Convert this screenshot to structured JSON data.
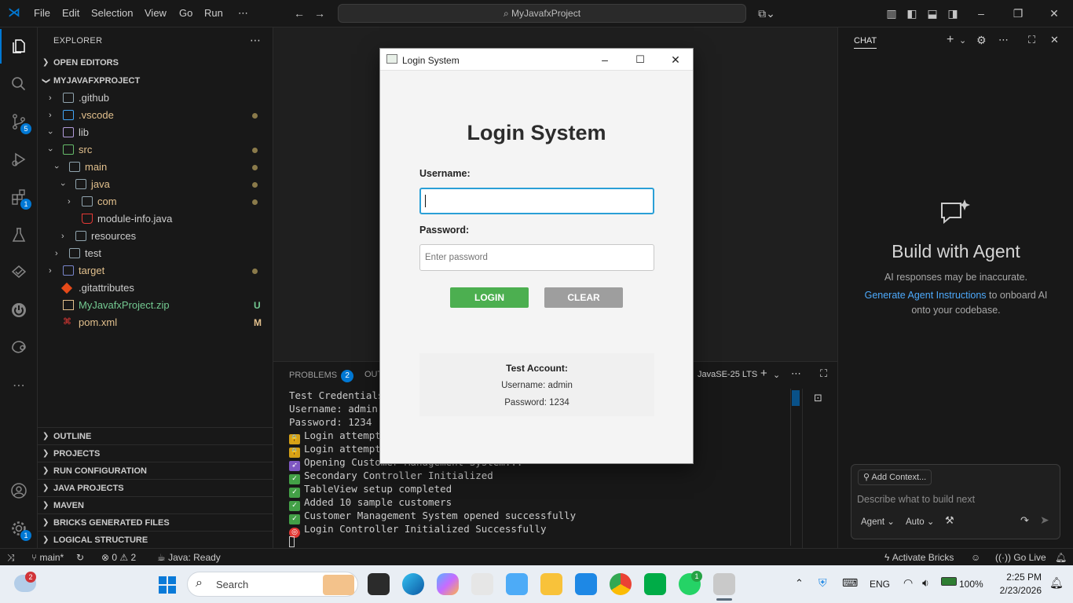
{
  "menu": {
    "file": "File",
    "edit": "Edit",
    "selection": "Selection",
    "view": "View",
    "go": "Go",
    "run": "Run",
    "more": "⋯"
  },
  "search": {
    "text": "MyJavafxProject"
  },
  "activity": {
    "scm_badge": "5",
    "ext_badge": "1",
    "accounts_badge": "1"
  },
  "explorer": {
    "title": "EXPLORER",
    "open_editors": "OPEN EDITORS",
    "project": "MYJAVAFXPROJECT",
    "items": [
      {
        "label": ".github",
        "color": "#cccccc"
      },
      {
        "label": ".vscode",
        "color": "#e2c08d"
      },
      {
        "label": "lib",
        "color": "#cccccc"
      },
      {
        "label": "src",
        "color": "#e2c08d"
      },
      {
        "label": "main",
        "color": "#e2c08d"
      },
      {
        "label": "java",
        "color": "#e2c08d"
      },
      {
        "label": "com",
        "color": "#e2c08d"
      },
      {
        "label": "module-info.java",
        "color": "#cccccc"
      },
      {
        "label": "resources",
        "color": "#cccccc"
      },
      {
        "label": "test",
        "color": "#cccccc"
      },
      {
        "label": "target",
        "color": "#e2c08d"
      },
      {
        "label": ".gitattributes",
        "color": "#cccccc"
      },
      {
        "label": "MyJavafxProject.zip",
        "color": "#73c991"
      },
      {
        "label": "pom.xml",
        "color": "#e2c08d"
      }
    ],
    "marks": {
      "zip": "U",
      "pom": "M"
    },
    "sections": [
      "OUTLINE",
      "PROJECTS",
      "RUN CONFIGURATION",
      "JAVA PROJECTS",
      "MAVEN",
      "BRICKS GENERATED FILES",
      "LOGICAL STRUCTURE"
    ]
  },
  "panel": {
    "problems": "PROBLEMS",
    "problems_count": "2",
    "output": "OUT",
    "jdk": "JavaSE-25 LTS",
    "lines": [
      {
        "icon": "",
        "text": "Test Credentials"
      },
      {
        "icon": "",
        "text": "Username: admin"
      },
      {
        "icon": "",
        "text": "Password: 1234"
      },
      {
        "icon": "lock",
        "text": "Login attempt"
      },
      {
        "icon": "lock",
        "text": "Login attempt"
      },
      {
        "icon": "rocket",
        "text": "Opening Customer Management System..."
      },
      {
        "icon": "check",
        "text": "Secondary Controller Initialized"
      },
      {
        "icon": "check",
        "text": "TableView setup completed"
      },
      {
        "icon": "check",
        "text": "Added 10 sample customers"
      },
      {
        "icon": "check",
        "text": "Customer Management System opened successfully"
      },
      {
        "icon": "target",
        "text": "Login Controller Initialized Successfully"
      }
    ]
  },
  "chat": {
    "tab": "CHAT",
    "heading": "Build with Agent",
    "disclaimer": "AI responses may be inaccurate.",
    "link": "Generate Agent Instructions",
    "rest1": " to onboard AI",
    "rest2": "onto your codebase.",
    "add_context": "Add Context...",
    "placeholder": "Describe what to build next",
    "mode": "Agent",
    "model": "Auto"
  },
  "status": {
    "branch": "main*",
    "errors": "0",
    "warnings": "2",
    "java": "Java: Ready",
    "bricks": "Activate Bricks",
    "golive": "Go Live"
  },
  "login": {
    "window_title": "Login System",
    "heading": "Login System",
    "username_label": "Username:",
    "username_value": "",
    "password_label": "Password:",
    "password_placeholder": "Enter password",
    "login_btn": "LOGIN",
    "clear_btn": "CLEAR",
    "test_title": "Test Account:",
    "test_user": "Username: admin",
    "test_pass": "Password: 1234"
  },
  "taskbar": {
    "search": "Search",
    "weather_badge": "2",
    "whatsapp_badge": "1",
    "lang": "ENG",
    "battery": "100%",
    "time": "2:25 PM",
    "date": "2/23/2026"
  },
  "colors": {
    "accent": "#0078d4",
    "login_green": "#4caf50",
    "clear_gray": "#9e9e9e",
    "link": "#4daafc"
  }
}
